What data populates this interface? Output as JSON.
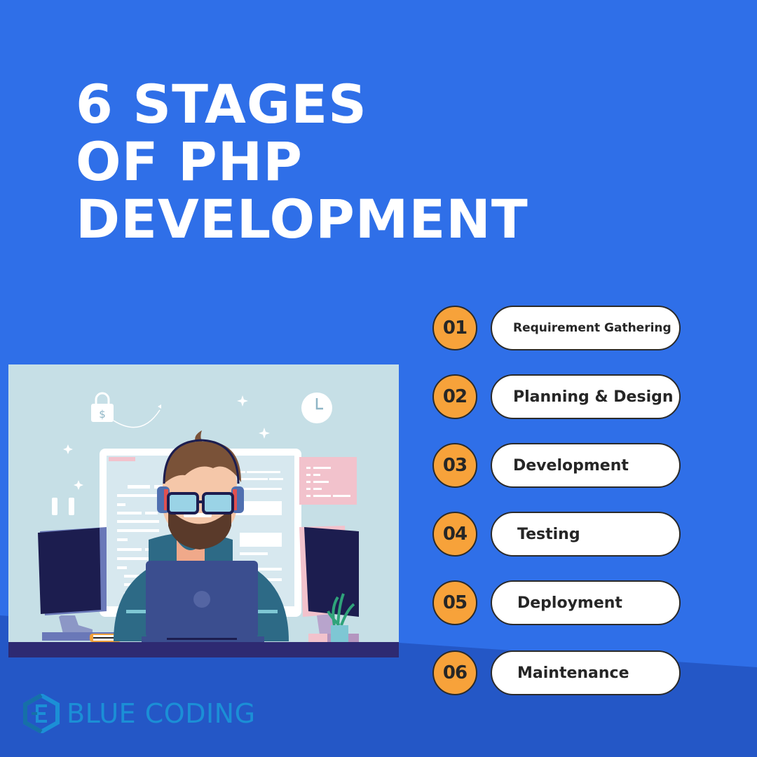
{
  "title": {
    "lines": [
      "6 STAGES",
      "OF PHP",
      "DEVELOPMENT"
    ]
  },
  "colors": {
    "background": "#2f6fe8",
    "background_lower": "#2457c6",
    "badge": "#f7a23a",
    "pill": "#ffffff",
    "text_dark": "#262626",
    "logo": "#1b8fd6"
  },
  "stages": [
    {
      "number": "01",
      "label": "Requirement Gathering"
    },
    {
      "number": "02",
      "label": "Planning & Design"
    },
    {
      "number": "03",
      "label": "Development"
    },
    {
      "number": "04",
      "label": "Testing"
    },
    {
      "number": "05",
      "label": "Deployment"
    },
    {
      "number": "06",
      "label": "Maintenance"
    }
  ],
  "illustration": {
    "description": "developer with headphones and glasses working on laptop between two monitors",
    "icons": [
      "lock-dollar-icon",
      "clock-icon",
      "sparkle-icon",
      "plant-icon",
      "book-icon"
    ],
    "currency_symbol": "$"
  },
  "logo": {
    "text": "BLUE CODING",
    "icon": "hexagon-e-logo-icon"
  }
}
